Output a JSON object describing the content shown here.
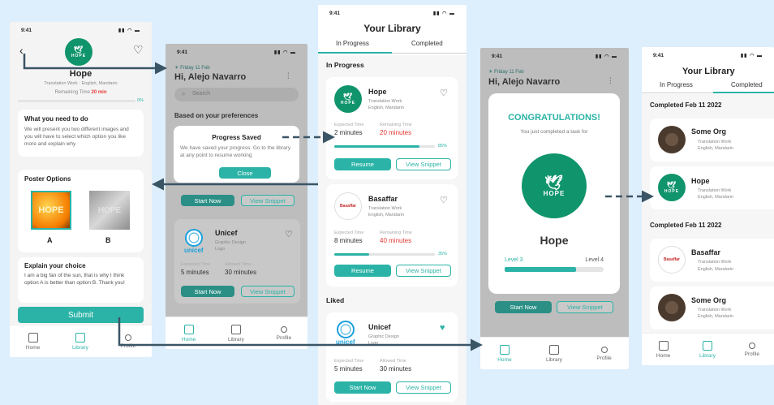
{
  "screens": {
    "s1": {
      "time": "9:41",
      "task_name": "Hope",
      "tag_category": "Translation Work",
      "tag_language": "English, Mandarin",
      "remaining_label": "Remaining Time",
      "remaining_value": "20 min",
      "progress_label": "0%",
      "progress_fraction": 0.0,
      "need_title": "What you need to do",
      "need_text": "We will present you two different images and you will have to select which option you like more and explain why",
      "poster_title": "Poster Options",
      "option_a": "A",
      "option_b": "B",
      "poster_text": "HOPE",
      "explain_title": "Explain your choice",
      "explain_text": "I am a big fan of the sun, that is why I think option A is better than option B. Thank you!",
      "submit_label": "Submit",
      "nav": [
        "Home",
        "Library",
        "Profile"
      ]
    },
    "s2": {
      "time": "9:41",
      "date": "Friday 11 Feb",
      "greeting": "Hi, Alejo Navarro",
      "search_placeholder": "Search",
      "section": "Based on your preferences",
      "modal_title": "Progress Saved",
      "modal_text": "We have saved your progress. Go to the library at any point to resume working",
      "modal_close": "Close",
      "start_now": "Start Now",
      "view_snippet": "View Snippet",
      "org_name": "Unicef",
      "org_category": "Graphic Design",
      "org_tag": "Logo",
      "expected_label": "Expected Time",
      "expected_value": "5 minutes",
      "allowed_label": "Allowed Time",
      "allowed_value": "30 minutes",
      "nav": [
        "Home",
        "Library",
        "Profile"
      ]
    },
    "s3": {
      "time": "9:41",
      "title": "Your Library",
      "tab_in_progress": "In Progress",
      "tab_completed": "Completed",
      "section_in_progress": "In Progress",
      "section_liked": "Liked",
      "items": [
        {
          "name": "Hope",
          "category": "Translation Work",
          "language": "English, Mandarin",
          "expected_label": "Expected Time",
          "expected": "2 minutes",
          "remaining_label": "Remaining Time",
          "remaining": "20 minutes",
          "pct": "85%",
          "progress_fraction": 0.85,
          "primary": "Resume",
          "secondary": "View Snippet"
        },
        {
          "name": "Basaffar",
          "category": "Translation Work",
          "language": "English, Mandarin",
          "expected_label": "Expected Time",
          "expected": "8 minutes",
          "remaining_label": "Remaining Time",
          "remaining": "40 minutes",
          "pct": "35%",
          "progress_fraction": 0.35,
          "primary": "Resume",
          "secondary": "View Snippet"
        }
      ],
      "liked": {
        "name": "Unicef",
        "category": "Graphic Design",
        "tag": "Logo",
        "expected_label": "Expected Time",
        "expected": "5 minutes",
        "allowed_label": "Allowed Time",
        "allowed": "30 minutes",
        "primary": "Start Now",
        "secondary": "View Snippet"
      }
    },
    "s4": {
      "time": "9:41",
      "date": "Friday 11 Feb",
      "greeting": "Hi, Alejo Navarro",
      "congrats_title": "CONGRATULATIONS!",
      "congrats_text": "You just completed a task for",
      "org_name": "Hope",
      "logo_text": "HOPE",
      "level_from": "Level 3",
      "level_to": "Level 4",
      "level_fraction": 0.72,
      "start_now": "Start Now",
      "view_snippet": "View Snippet",
      "nav": [
        "Home",
        "Library",
        "Profile"
      ]
    },
    "s5": {
      "time": "9:41",
      "title": "Your Library",
      "tab_in_progress": "In Progress",
      "tab_completed": "Completed",
      "groups": [
        {
          "heading": "Completed Feb 11 2022",
          "items": [
            {
              "name": "Some Org",
              "category": "Translation Work",
              "language": "English, Mandarin"
            },
            {
              "name": "Hope",
              "category": "Translation Work",
              "language": "English, Mandarin"
            }
          ]
        },
        {
          "heading": "Completed Feb 11 2022",
          "items": [
            {
              "name": "Basaffar",
              "category": "Translation Work",
              "language": "English, Mandarin"
            },
            {
              "name": "Some Org",
              "category": "Translation Work",
              "language": "English, Mandarin"
            }
          ]
        }
      ],
      "nav": [
        "Home",
        "Library",
        "Profile"
      ]
    }
  },
  "colors": {
    "accent": "#2ab3a6",
    "hope_green": "#10946b",
    "alert_red": "#e53935",
    "background": "#ddeefc"
  },
  "icons": [
    "back-arrow-icon",
    "heart-icon",
    "search-icon",
    "filter-icon",
    "home-icon",
    "library-icon",
    "profile-icon",
    "sun-icon",
    "dove-icon"
  ]
}
